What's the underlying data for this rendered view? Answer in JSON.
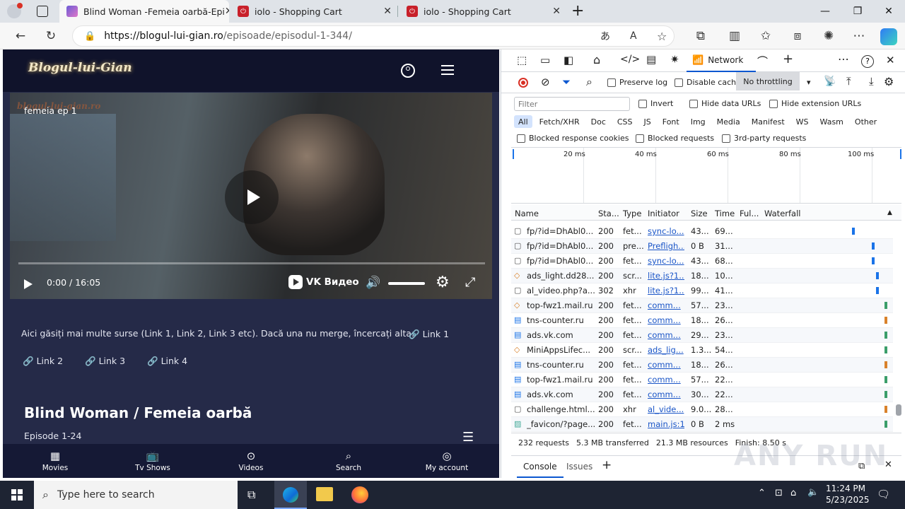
{
  "browser": {
    "tabs": [
      {
        "title": "Blind Woman -Femeia oarbă-Epi",
        "active": true
      },
      {
        "title": "iolo - Shopping Cart",
        "active": false
      },
      {
        "title": "iolo - Shopping Cart",
        "active": false
      }
    ],
    "url_host": "https://blogul-lui-gian.ro",
    "url_path": "/episoade/episodul-1-344/"
  },
  "site": {
    "logo": "Blogul-lui-Gian",
    "watermark": "blogul-lui-gian.ro",
    "video_title": "femeia ep 1",
    "time": "0:00 / 16:05",
    "vk_label": "VK Видео",
    "sources_text": "Aici găsiți mai multe surse (Link 1, Link 2, Link 3 etc). Dacă una nu merge, încercați alta:",
    "links": [
      "Link 1",
      "Link 2",
      "Link 3",
      "Link 4"
    ],
    "show_title": "Blind Woman / Femeia oarbă",
    "episodes": "Episode 1-24",
    "nav": [
      "Movies",
      "Tv Shows",
      "Videos",
      "Search",
      "My account"
    ]
  },
  "devtools": {
    "active_panel": "Network",
    "preserve_log": "Preserve log",
    "disable_cache": "Disable cache",
    "throttle": "No throttling",
    "filter_placeholder": "Filter",
    "invert": "Invert",
    "hide_data": "Hide data URLs",
    "hide_ext": "Hide extension URLs",
    "types": [
      "All",
      "Fetch/XHR",
      "Doc",
      "CSS",
      "JS",
      "Font",
      "Img",
      "Media",
      "Manifest",
      "WS",
      "Wasm",
      "Other"
    ],
    "blocked_cookies": "Blocked response cookies",
    "blocked_requests": "Blocked requests",
    "third_party": "3rd-party requests",
    "timeline_ticks": [
      "20 ms",
      "40 ms",
      "60 ms",
      "80 ms",
      "100 ms"
    ],
    "columns": [
      "Name",
      "Sta...",
      "Type",
      "Initiator",
      "Size",
      "Time",
      "Ful...",
      "Waterfall"
    ],
    "rows": [
      {
        "name": "fp/?id=DhAbl0...",
        "status": "200",
        "type": "fet...",
        "init": "sync-lo...",
        "size": "43...",
        "time": "69...",
        "icon": "doc"
      },
      {
        "name": "fp/?id=DhAbl0...",
        "status": "200",
        "type": "pre...",
        "init": "Prefligh...",
        "size": "0 B",
        "time": "31...",
        "icon": "doc"
      },
      {
        "name": "fp/?id=DhAbl0...",
        "status": "200",
        "type": "fet...",
        "init": "sync-lo...",
        "size": "43...",
        "time": "68...",
        "icon": "doc"
      },
      {
        "name": "ads_light.dd28...",
        "status": "200",
        "type": "scr...",
        "init": "lite.js?1...",
        "size": "18...",
        "time": "10...",
        "icon": "script"
      },
      {
        "name": "al_video.php?a...",
        "status": "302",
        "type": "xhr",
        "init": "lite.js?1...",
        "size": "99...",
        "time": "41...",
        "icon": "doc"
      },
      {
        "name": "top-fwz1.mail.ru",
        "status": "200",
        "type": "fet...",
        "init": "comm...",
        "size": "57...",
        "time": "23...",
        "icon": "script"
      },
      {
        "name": "tns-counter.ru",
        "status": "200",
        "type": "fet...",
        "init": "comm...",
        "size": "18...",
        "time": "26...",
        "icon": "fetch"
      },
      {
        "name": "ads.vk.com",
        "status": "200",
        "type": "fet...",
        "init": "comm...",
        "size": "29...",
        "time": "23...",
        "icon": "fetch"
      },
      {
        "name": "MiniAppsLifec...",
        "status": "200",
        "type": "scr...",
        "init": "ads_lig...",
        "size": "1.3...",
        "time": "54...",
        "icon": "script"
      },
      {
        "name": "tns-counter.ru",
        "status": "200",
        "type": "fet...",
        "init": "comm...",
        "size": "18...",
        "time": "26...",
        "icon": "fetch"
      },
      {
        "name": "top-fwz1.mail.ru",
        "status": "200",
        "type": "fet...",
        "init": "comm...",
        "size": "57...",
        "time": "22...",
        "icon": "fetch"
      },
      {
        "name": "ads.vk.com",
        "status": "200",
        "type": "fet...",
        "init": "comm...",
        "size": "30...",
        "time": "22...",
        "icon": "fetch"
      },
      {
        "name": "challenge.html...",
        "status": "200",
        "type": "xhr",
        "init": "al_vide...",
        "size": "9.0...",
        "time": "28...",
        "icon": "doc"
      },
      {
        "name": "_favicon/?page...",
        "status": "200",
        "type": "fet...",
        "init": "main.js:1",
        "size": "0 B",
        "time": "2 ms",
        "icon": "img"
      }
    ],
    "summary_requests": "232 requests",
    "summary_transferred": "5.3 MB transferred",
    "summary_resources": "21.3 MB resources",
    "summary_finish": "Finish: 8.50 s",
    "drawer_tabs": [
      "Console",
      "Issues"
    ]
  },
  "taskbar": {
    "search_placeholder": "Type here to search",
    "time": "11:24 PM",
    "date": "5/23/2025"
  },
  "watermark": "ANY RUN"
}
